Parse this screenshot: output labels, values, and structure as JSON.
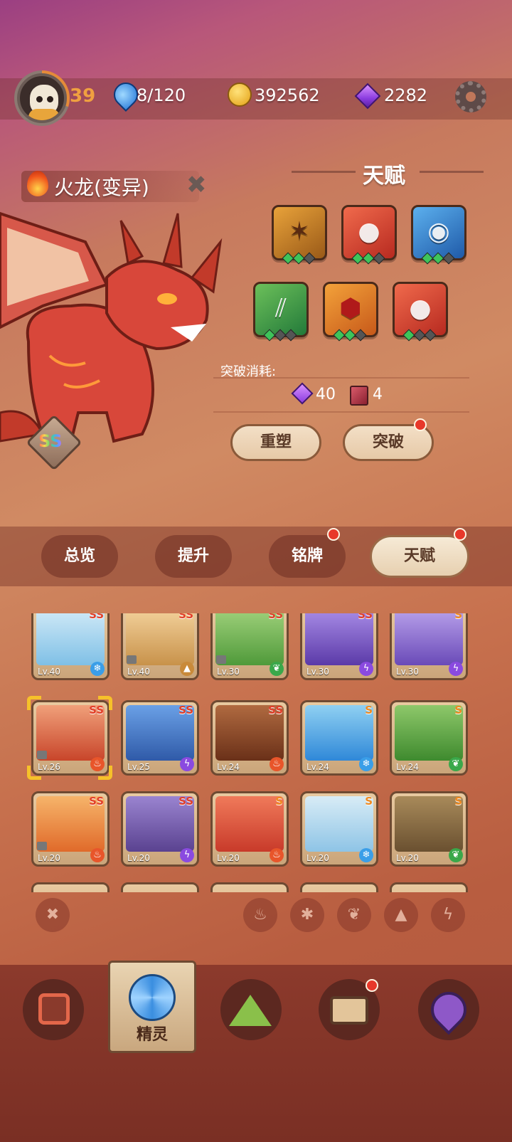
{
  "player": {
    "level": "39"
  },
  "resources": {
    "stamina": "8/120",
    "coins": "392562",
    "gems": "2282"
  },
  "pet": {
    "name": "火龙(变异)",
    "rank": "SS"
  },
  "talent": {
    "title": "天赋",
    "breakthrough_label": "突破消耗:",
    "cost_gems": "40",
    "cost_books": "4",
    "reshape_label": "重塑",
    "breakthrough_button": "突破"
  },
  "tabs": [
    {
      "label": "总览"
    },
    {
      "label": "提升"
    },
    {
      "label": "铭牌"
    },
    {
      "label": "天赋"
    }
  ],
  "cards": [
    {
      "level": "Lv.40",
      "rank": "SS",
      "element": "ice"
    },
    {
      "level": "Lv.40",
      "rank": "SS",
      "element": "rock"
    },
    {
      "level": "Lv.30",
      "rank": "SS",
      "element": "grass"
    },
    {
      "level": "Lv.30",
      "rank": "SS",
      "element": "thunder"
    },
    {
      "level": "Lv.30",
      "rank": "S",
      "element": "thunder"
    },
    {
      "level": "Lv.26",
      "rank": "SS",
      "element": "fire"
    },
    {
      "level": "Lv.25",
      "rank": "SS",
      "element": "thunder"
    },
    {
      "level": "Lv.24",
      "rank": "SS",
      "element": "fire"
    },
    {
      "level": "Lv.24",
      "rank": "S",
      "element": "ice"
    },
    {
      "level": "Lv.24",
      "rank": "S",
      "element": "grass"
    },
    {
      "level": "Lv.20",
      "rank": "SS",
      "element": "fire"
    },
    {
      "level": "Lv.20",
      "rank": "SS",
      "element": "thunder"
    },
    {
      "level": "Lv.20",
      "rank": "S",
      "element": "fire"
    },
    {
      "level": "Lv.20",
      "rank": "S",
      "element": "ice"
    },
    {
      "level": "Lv.20",
      "rank": "S",
      "element": "grass"
    }
  ],
  "bottom_nav": {
    "active_label": "精灵"
  },
  "colors": {
    "accent_red_dot": "#e8382a",
    "level_orange": "#f0a040"
  }
}
